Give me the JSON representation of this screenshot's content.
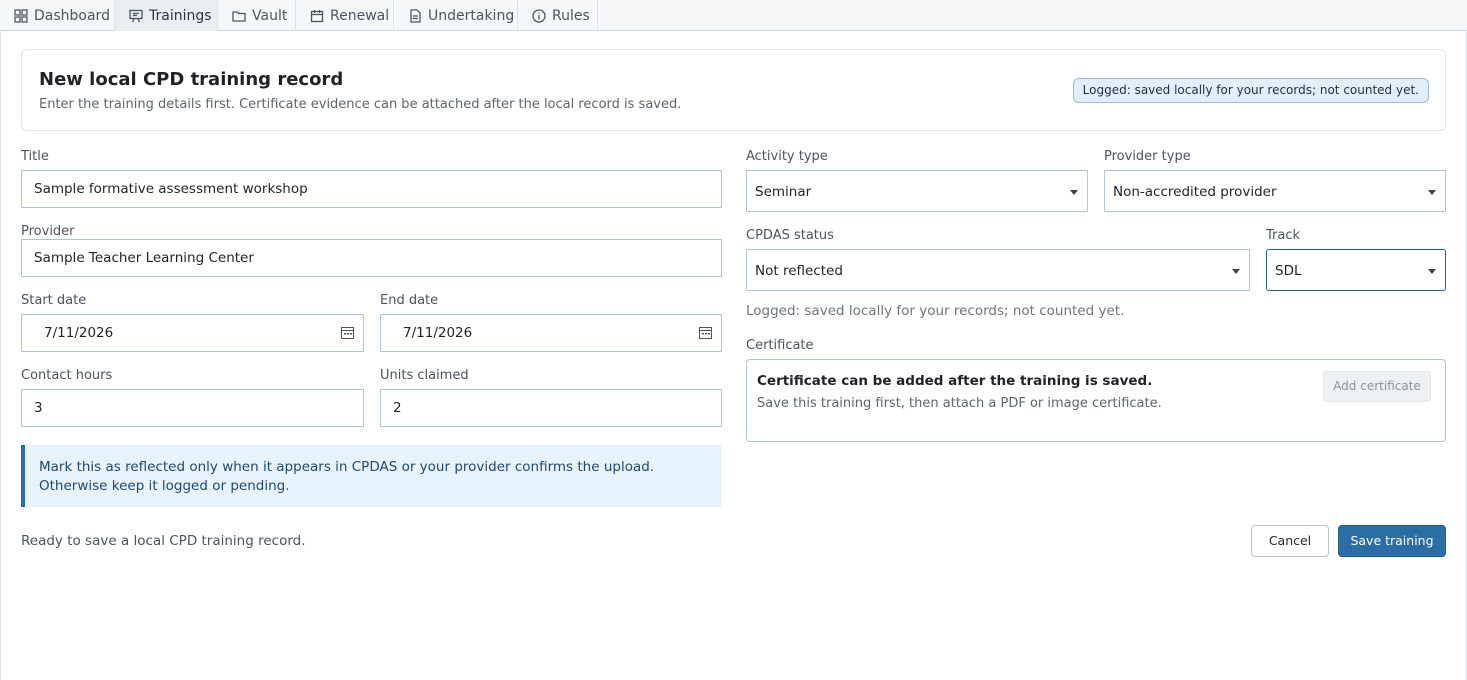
{
  "tabs": [
    {
      "label": "Dashboard",
      "icon": "grid-icon"
    },
    {
      "label": "Trainings",
      "icon": "presentation-icon",
      "active": true
    },
    {
      "label": "Vault",
      "icon": "folder-icon"
    },
    {
      "label": "Renewal",
      "icon": "calendar-icon"
    },
    {
      "label": "Undertaking",
      "icon": "document-icon"
    },
    {
      "label": "Rules",
      "icon": "info-icon"
    }
  ],
  "header": {
    "title": "New local CPD training record",
    "subtitle": "Enter the training details first. Certificate evidence can be attached after the local record is saved.",
    "badge": "Logged: saved locally for your records; not counted yet."
  },
  "form": {
    "title_label": "Title",
    "title_value": "Sample formative assessment workshop",
    "provider_label": "Provider",
    "provider_value": "Sample Teacher Learning Center",
    "start_label": "Start date",
    "start_value": "7/11/2026",
    "end_label": "End date",
    "end_value": "7/11/2026",
    "hours_label": "Contact hours",
    "hours_value": "3",
    "units_label": "Units claimed",
    "units_value": "2",
    "activity_label": "Activity type",
    "activity_value": "Seminar",
    "provider_type_label": "Provider type",
    "provider_type_value": "Non-accredited provider",
    "cpdas_label": "CPDAS status",
    "cpdas_value": "Not reflected",
    "track_label": "Track",
    "track_value": "SDL",
    "status_line": "Logged: saved locally for your records; not counted yet.",
    "certificate_label": "Certificate"
  },
  "notice": "Mark this as reflected only when it appears in CPDAS or your provider confirms the upload. Otherwise keep it logged or pending.",
  "certificate": {
    "title": "Certificate can be added after the training is saved.",
    "subtitle": "Save this training first, then attach a PDF or image certificate.",
    "button": "Add certificate"
  },
  "footer": {
    "ready_text": "Ready to save a local CPD training record.",
    "cancel_label": "Cancel",
    "save_label": "Save training"
  },
  "colors": {
    "accent": "#2b6ea6",
    "badge_bg": "#e3eefa",
    "notice_bg": "#e8f2fb"
  }
}
